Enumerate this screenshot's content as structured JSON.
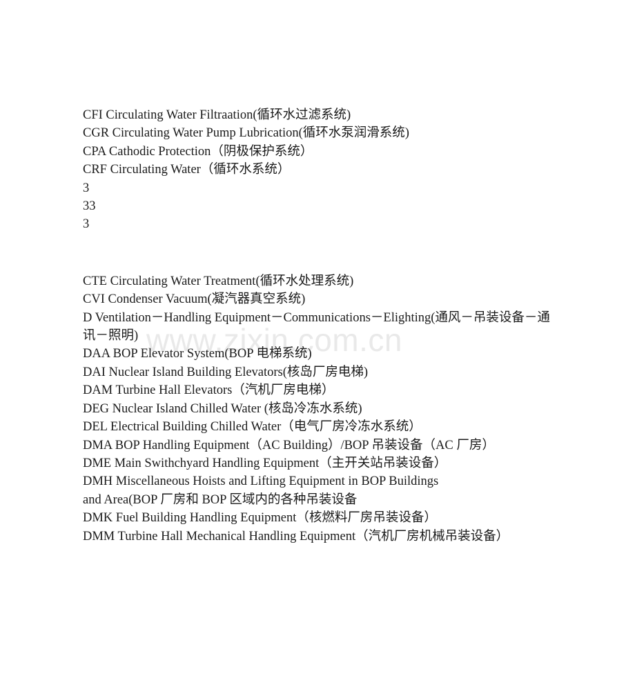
{
  "document": {
    "background_color": "#ffffff",
    "text_color": "#1a1a1a",
    "watermark": {
      "text": "www.zixin.com.cn",
      "color": "#e9e9e9"
    },
    "blocks": [
      {
        "id": "block-1",
        "lines": [
          "CFI Circulating Water Filtraation(循环水过滤系统)",
          "CGR Circulating Water Pump Lubrication(循环水泵润滑系统)",
          "CPA Cathodic Protection（阴极保护系统）",
          "CRF Circulating Water（循环水系统）",
          "3",
          "33",
          "3"
        ]
      },
      {
        "id": "block-2",
        "lines": [
          "CTE Circulating Water Treatment(循环水处理系统)",
          "CVI Condenser Vacuum(凝汽器真空系统)",
          "D Ventilation－Handling Equipment－Communications－Elighting(通风－吊装设备－通讯－照明)",
          "DAA BOP Elevator System(BOP 电梯系统)",
          "DAI Nuclear Island Building Elevators(核岛厂房电梯)",
          "DAM Turbine Hall Elevators（汽机厂房电梯）",
          "DEG Nuclear Island Chilled Water (核岛冷冻水系统)",
          "DEL Electrical Building Chilled Water（电气厂房冷冻水系统）",
          "DMA BOP Handling Equipment（AC Building）/BOP 吊装设备（AC 厂房）",
          "DME Main Swithchyard Handling Equipment（主开关站吊装设备）",
          "DMH Miscellaneous Hoists and Lifting Equipment in BOP Buildings",
          "and Area(BOP 厂房和 BOP 区域内的各种吊装设备",
          "DMK Fuel Building Handling Equipment（核燃料厂房吊装设备）",
          "DMM Turbine Hall Mechanical Handling Equipment（汽机厂房机械吊装设备）"
        ]
      }
    ]
  }
}
